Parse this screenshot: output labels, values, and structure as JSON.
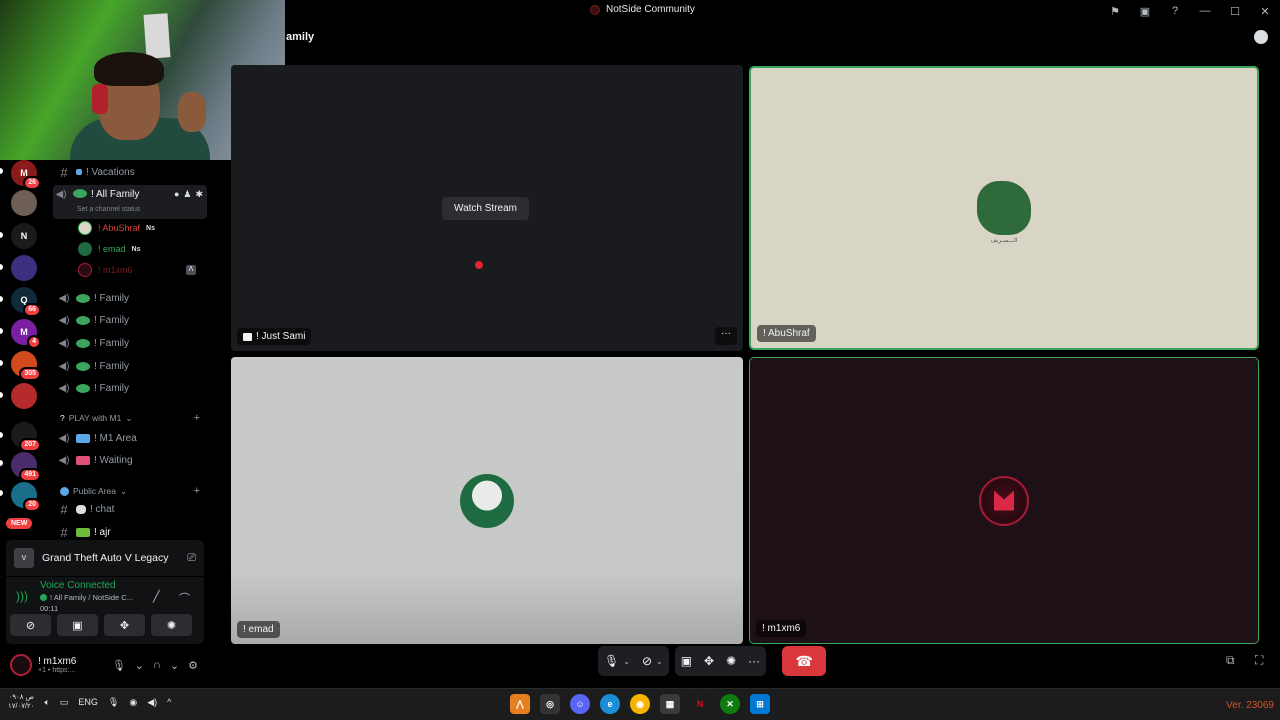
{
  "window": {
    "title": "NotSide Community"
  },
  "header": {
    "channel_title": "amily"
  },
  "servers": [
    {
      "color": "#8b1a1a",
      "badge": "26",
      "label": "M"
    },
    {
      "color": "#6d5f55",
      "badge": "",
      "label": ""
    },
    {
      "color": "#1a1a1a",
      "badge": "",
      "label": "N"
    },
    {
      "color": "#3d3080",
      "badge": "",
      "label": ""
    },
    {
      "color": "#0f2b3a",
      "badge": "66",
      "label": "Q"
    },
    {
      "color": "#7a1fa2",
      "badge": "4",
      "label": "M"
    },
    {
      "color": "#d04a1d",
      "badge": "305",
      "label": ""
    },
    {
      "color": "#b52a2a",
      "badge": "",
      "label": ""
    },
    {
      "color": "#1b1b1b",
      "badge": "207",
      "label": ""
    },
    {
      "color": "#4a2c6b",
      "badge": "491",
      "label": ""
    },
    {
      "color": "#1a6e8a",
      "badge": "20",
      "label": ""
    }
  ],
  "new_badge": "NEW",
  "channels": {
    "vacations": "! Vacations",
    "all_family": "! All Family",
    "all_family_status": "Set a channel status",
    "voice_users": [
      {
        "name": "! AbuShraf",
        "tag": "Ns",
        "color": "#e03c3c"
      },
      {
        "name": "! emad",
        "tag": "Ns",
        "color": "#3ba55d"
      },
      {
        "name": "! m1xm6",
        "tag": "",
        "color": "#7a1c1c"
      }
    ],
    "family_rooms": [
      "! Family",
      "! Family",
      "! Family",
      "! Family",
      "! Family"
    ],
    "cat_play": "PLAY with M1",
    "m1_area": "! M1 Area",
    "waiting": "! Waiting",
    "cat_public": "Public Area",
    "chat": "! chat",
    "ajr": "! ajr"
  },
  "activity": {
    "game": "Grand Theft Auto V Legacy"
  },
  "voice": {
    "status": "Voice Connected",
    "location": "! All Family / NotSide C...",
    "time": "00:11"
  },
  "user": {
    "name": "! m1xm6",
    "sub": "+1 • https:..."
  },
  "tiles": [
    {
      "name": "! Just Sami",
      "button": "Watch Stream"
    },
    {
      "name": "! AbuShraf",
      "caption": "الـــسـريف"
    },
    {
      "name": "! emad"
    },
    {
      "name": "! m1xm6"
    }
  ],
  "taskbar": {
    "clock_time": "ص ٠٩٠٨",
    "clock_date": "١٧/٠٧/٢٠",
    "lang": "ENG",
    "version": "Ver. 23069"
  }
}
